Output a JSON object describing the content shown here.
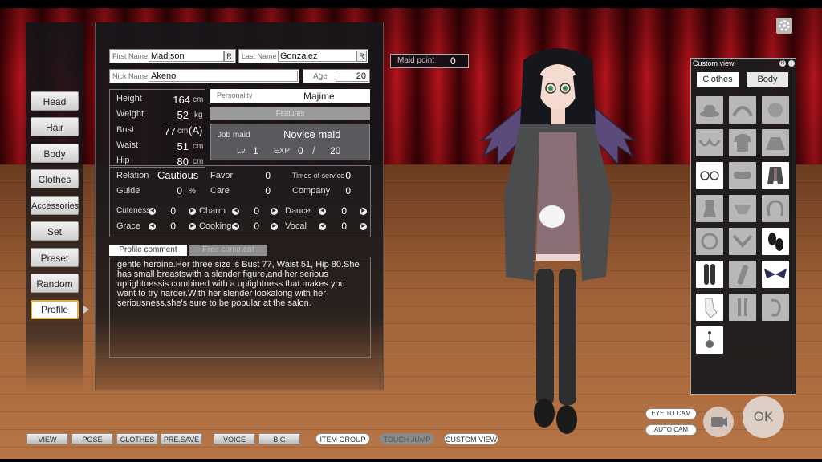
{
  "left_nav": [
    "Head",
    "Hair",
    "Body",
    "Clothes",
    "Accessories",
    "Set",
    "Preset",
    "Random",
    "Profile"
  ],
  "names": {
    "first_label": "First Name",
    "first_value": "Madison",
    "last_label": "Last Name",
    "last_value": "Gonzalez",
    "nick_label": "Nick Name",
    "nick_value": "Akeno",
    "age_label": "Age",
    "age_value": "20",
    "random_glyph": "R"
  },
  "body_stats": {
    "height_label": "Height",
    "height_value": "164",
    "height_unit": "cm",
    "weight_label": "Weight",
    "weight_value": "52",
    "weight_unit": "kg",
    "bust_label": "Bust",
    "bust_value": "77",
    "bust_unit": "cm",
    "bust_cup": "(A)",
    "waist_label": "Waist",
    "waist_value": "51",
    "waist_unit": "cm",
    "hip_label": "Hip",
    "hip_value": "80",
    "hip_unit": "cm"
  },
  "personality": {
    "label": "Personality",
    "value": "Majime",
    "features_label": "Features"
  },
  "job": {
    "label": "Job maid",
    "value": "Novice maid",
    "lv_label": "Lv.",
    "lv_value": "1",
    "exp_label": "EXP",
    "exp_value": "0",
    "exp_sep": "/",
    "exp_max": "20"
  },
  "relations": {
    "relation_label": "Relation",
    "relation_value": "Cautious",
    "favor_label": "Favor",
    "favor_value": "0",
    "service_label": "Times of service",
    "service_value": "0",
    "guide_label": "Guide",
    "guide_value": "0",
    "guide_unit": "%",
    "care_label": "Care",
    "care_value": "0",
    "company_label": "Company",
    "company_value": "0"
  },
  "skills": [
    {
      "name": "Cuteness",
      "value": "0"
    },
    {
      "name": "Charm",
      "value": "0"
    },
    {
      "name": "Dance",
      "value": "0"
    },
    {
      "name": "Grace",
      "value": "0"
    },
    {
      "name": "Cooking",
      "value": "0"
    },
    {
      "name": "Vocal",
      "value": "0"
    }
  ],
  "comment": {
    "tab_profile": "Profile comment",
    "tab_free": "Free comment",
    "text": "gentle heroine.Her three size is Bust 77, Waist 51, Hip 80.She has small breastswith a slender figure,and her serious uptightnessis combined with a uptightness that makes you want to try harder.With her slender lookalong with her seriousness,she's sure to be popular at the salon."
  },
  "maid_point": {
    "label": "Maid point",
    "value": "0"
  },
  "custom_view": {
    "title": "Custom view",
    "title_glyph": "R",
    "tab_clothes": "Clothes",
    "tab_body": "Body",
    "slots": [
      {
        "icon": "hat-icon",
        "active": false
      },
      {
        "icon": "headband-icon",
        "active": false
      },
      {
        "icon": "hair-accessory-icon",
        "active": false
      },
      {
        "icon": "bra-icon",
        "active": false
      },
      {
        "icon": "top-icon",
        "active": false
      },
      {
        "icon": "skirt-icon",
        "active": false
      },
      {
        "icon": "glasses-icon",
        "active": true
      },
      {
        "icon": "eye-mask-icon",
        "active": false
      },
      {
        "icon": "coat-icon",
        "active": true
      },
      {
        "icon": "swimsuit-icon",
        "active": false
      },
      {
        "icon": "underwear-icon",
        "active": false
      },
      {
        "icon": "ears-icon",
        "active": false
      },
      {
        "icon": "necklace-icon",
        "active": false
      },
      {
        "icon": "collar-icon",
        "active": false
      },
      {
        "icon": "shoes-icon",
        "active": true
      },
      {
        "icon": "tights-icon",
        "active": true
      },
      {
        "icon": "arm-accessory-icon",
        "active": false
      },
      {
        "icon": "wings-icon",
        "active": true
      },
      {
        "icon": "gloves-icon",
        "active": true
      },
      {
        "icon": "belt-icon",
        "active": false
      },
      {
        "icon": "tail-icon",
        "active": false
      },
      {
        "icon": "earring-icon",
        "active": true
      }
    ]
  },
  "toolbar": {
    "view": "VIEW",
    "pose": "POSE",
    "clothes": "CLOTHES",
    "presave": "PRE.SAVE",
    "voice": "VOICE",
    "bg": "B G",
    "item_group": "ITEM GROUP",
    "touch_jump": "TOUCH JUMP",
    "custom_view": "CUSTOM VIEW",
    "eye_to_cam": "EYE TO CAM",
    "auto_cam": "AUTO CAM",
    "ok": "OK"
  },
  "colors": {
    "accent_gold": "#d9b24a",
    "curtain_red": "#b4141d",
    "panel_dark": "#16161a"
  }
}
